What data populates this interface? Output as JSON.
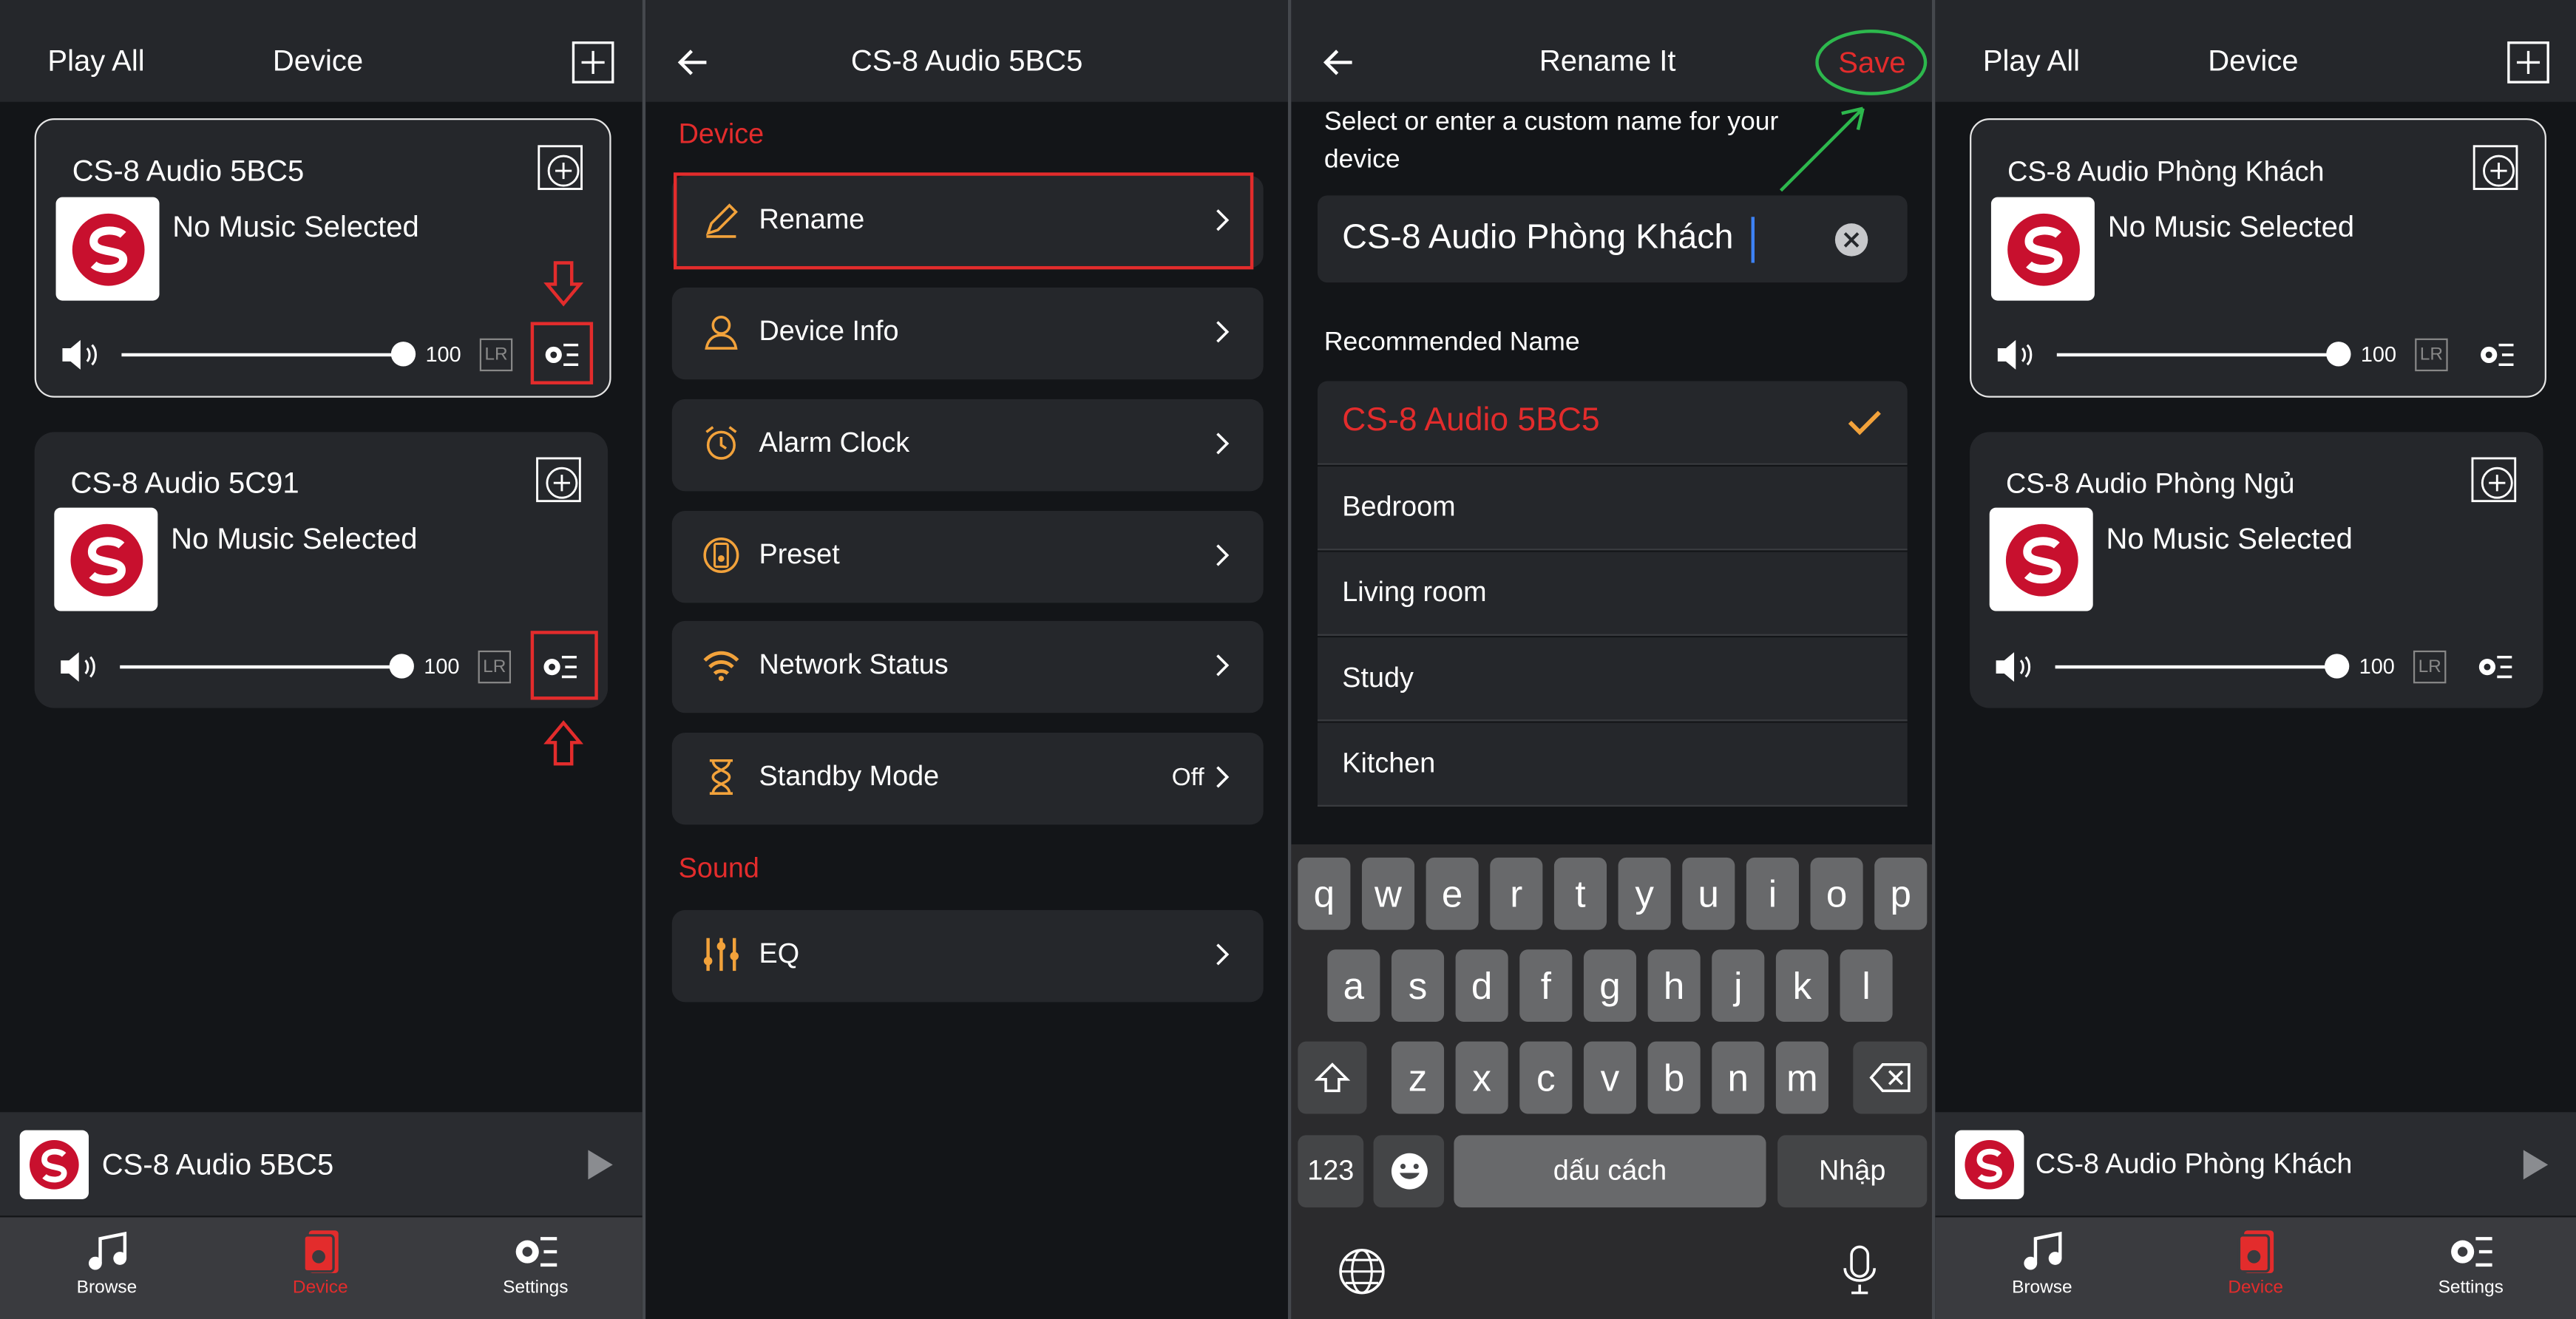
{
  "colors": {
    "accent_red": "#e32c2c",
    "icon_orange": "#f2a23b",
    "save_ring_green": "#2db84d",
    "check_orange": "#f2a23b"
  },
  "panel1": {
    "header": {
      "play_all": "Play  All",
      "title": "Device"
    },
    "devices": [
      {
        "name": "CS-8 Audio  5BC5",
        "music": "No Music Selected",
        "volume": "100",
        "lr": "LR",
        "selected": true
      },
      {
        "name": "CS-8 Audio  5C91",
        "music": "No Music Selected",
        "volume": "100",
        "lr": "LR",
        "selected": false
      }
    ],
    "mini_player": {
      "name": "CS-8 Audio  5BC5"
    },
    "tabs": [
      {
        "label": "Browse",
        "icon": "music-note-icon"
      },
      {
        "label": "Device",
        "icon": "speaker-icon"
      },
      {
        "label": "Settings",
        "icon": "settings-gear-icon"
      }
    ]
  },
  "panel2": {
    "header": {
      "title": "CS-8 Audio  5BC5"
    },
    "section_device": "Device",
    "rows": [
      {
        "label": "Rename",
        "icon": "pencil-icon"
      },
      {
        "label": "Device Info",
        "icon": "person-icon"
      },
      {
        "label": "Alarm Clock",
        "icon": "alarm-clock-icon"
      },
      {
        "label": "Preset",
        "icon": "preset-speaker-icon"
      },
      {
        "label": "Network Status",
        "icon": "wifi-icon"
      },
      {
        "label": "Standby Mode",
        "icon": "hourglass-icon",
        "value": "Off"
      }
    ],
    "section_sound": "Sound",
    "sound_rows": [
      {
        "label": "EQ",
        "icon": "equalizer-icon"
      }
    ]
  },
  "panel3": {
    "header": {
      "title": "Rename It",
      "save": "Save"
    },
    "prompt": "Select or enter a custom name for your device",
    "input_value": "CS-8 Audio Phòng Khách",
    "recommended_title": "Recommended Name",
    "recommended": [
      "CS-8 Audio  5BC5",
      "Bedroom",
      "Living room",
      "Study",
      "Kitchen"
    ],
    "keyboard": {
      "row1": [
        "q",
        "w",
        "e",
        "r",
        "t",
        "y",
        "u",
        "i",
        "o",
        "p"
      ],
      "row2": [
        "a",
        "s",
        "d",
        "f",
        "g",
        "h",
        "j",
        "k",
        "l"
      ],
      "row3": [
        "z",
        "x",
        "c",
        "v",
        "b",
        "n",
        "m"
      ],
      "num": "123",
      "space": "dấu cách",
      "enter": "Nhập"
    }
  },
  "panel4": {
    "header": {
      "play_all": "Play  All",
      "title": "Device"
    },
    "devices": [
      {
        "name": "CS-8 Audio Phòng Khách",
        "music": "No Music Selected",
        "volume": "100",
        "lr": "LR",
        "selected": true
      },
      {
        "name": "CS-8 Audio Phòng Ngủ",
        "music": "No Music Selected",
        "volume": "100",
        "lr": "LR",
        "selected": false
      }
    ],
    "mini_player": {
      "name": "CS-8 Audio Phòng Khách"
    },
    "tabs": [
      {
        "label": "Browse"
      },
      {
        "label": "Device"
      },
      {
        "label": "Settings"
      }
    ]
  }
}
